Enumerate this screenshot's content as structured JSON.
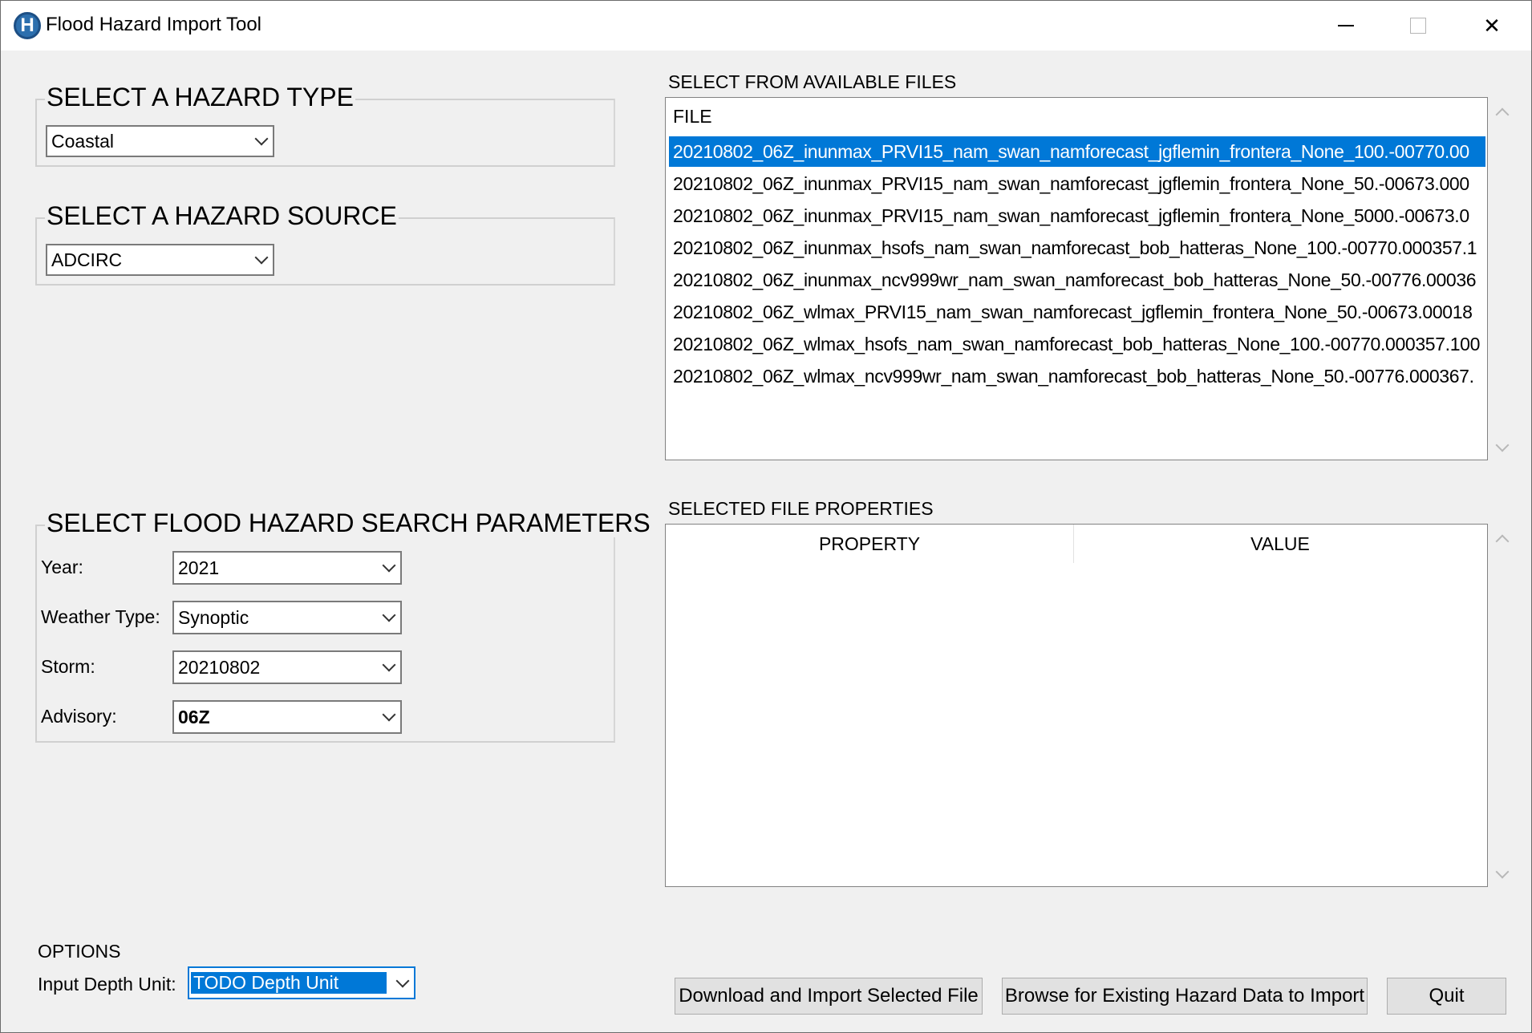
{
  "window": {
    "title": "Flood Hazard Import Tool",
    "icon": "H-logo-icon",
    "controls": [
      "minimize",
      "maximize",
      "close"
    ]
  },
  "hazard_type": {
    "legend": "SELECT A HAZARD TYPE",
    "selected": "Coastal"
  },
  "hazard_source": {
    "legend": "SELECT A HAZARD SOURCE",
    "selected": "ADCIRC"
  },
  "search_params": {
    "legend": "SELECT FLOOD HAZARD SEARCH PARAMETERS",
    "fields": [
      {
        "label": "Year:",
        "value": "2021"
      },
      {
        "label": "Weather Type:",
        "value": "Synoptic"
      },
      {
        "label": "Storm:",
        "value": "20210802"
      },
      {
        "label": "Advisory:",
        "value": "06Z"
      }
    ]
  },
  "options": {
    "heading": "OPTIONS",
    "depth_unit_label": "Input Depth Unit:",
    "depth_unit_value": "TODO Depth Unit"
  },
  "files": {
    "heading": "SELECT FROM AVAILABLE FILES",
    "column": "FILE",
    "selected_index": 0,
    "rows": [
      "20210802_06Z_inunmax_PRVI15_nam_swan_namforecast_jgflemin_frontera_None_100.-00770.00",
      "20210802_06Z_inunmax_PRVI15_nam_swan_namforecast_jgflemin_frontera_None_50.-00673.000",
      "20210802_06Z_inunmax_PRVI15_nam_swan_namforecast_jgflemin_frontera_None_5000.-00673.0",
      "20210802_06Z_inunmax_hsofs_nam_swan_namforecast_bob_hatteras_None_100.-00770.000357.1",
      "20210802_06Z_inunmax_ncv999wr_nam_swan_namforecast_bob_hatteras_None_50.-00776.00036",
      "20210802_06Z_wlmax_PRVI15_nam_swan_namforecast_jgflemin_frontera_None_50.-00673.00018",
      "20210802_06Z_wlmax_hsofs_nam_swan_namforecast_bob_hatteras_None_100.-00770.000357.100",
      "20210802_06Z_wlmax_ncv999wr_nam_swan_namforecast_bob_hatteras_None_50.-00776.000367."
    ]
  },
  "properties": {
    "heading": "SELECTED FILE PROPERTIES",
    "columns": [
      "PROPERTY",
      "VALUE"
    ]
  },
  "buttons": {
    "download": "Download and Import Selected File",
    "browse": "Browse for Existing Hazard Data to Import",
    "quit": "Quit"
  }
}
